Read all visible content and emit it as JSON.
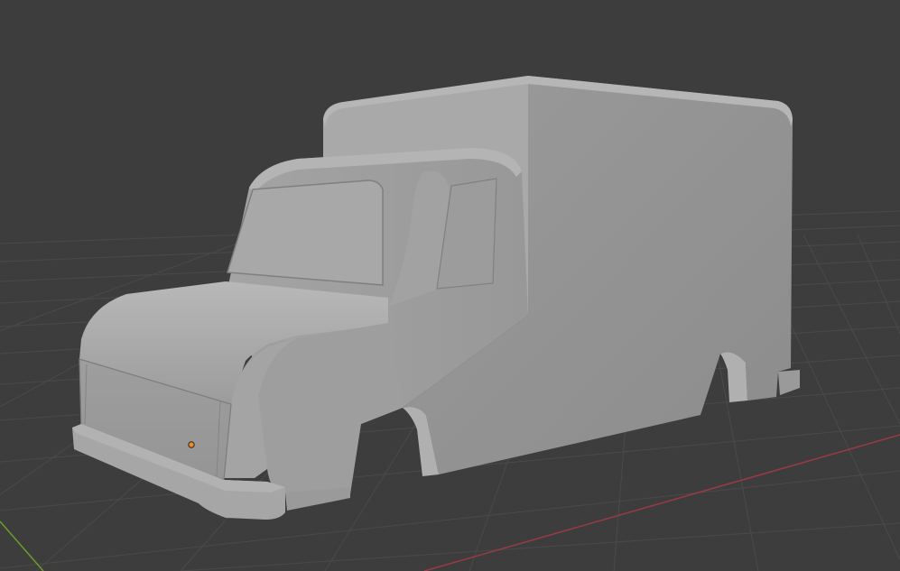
{
  "viewport": {
    "background_color": "#3d3d3d",
    "grid_color": "#4a4a4a",
    "x_axis_color": "#9a3a44",
    "y_axis_color": "#6f9a2e",
    "object_color": "#a6a6a6",
    "origin_color": "#f08a24",
    "object": "truck-body-mesh",
    "object_origin": "object-origin-dot"
  }
}
